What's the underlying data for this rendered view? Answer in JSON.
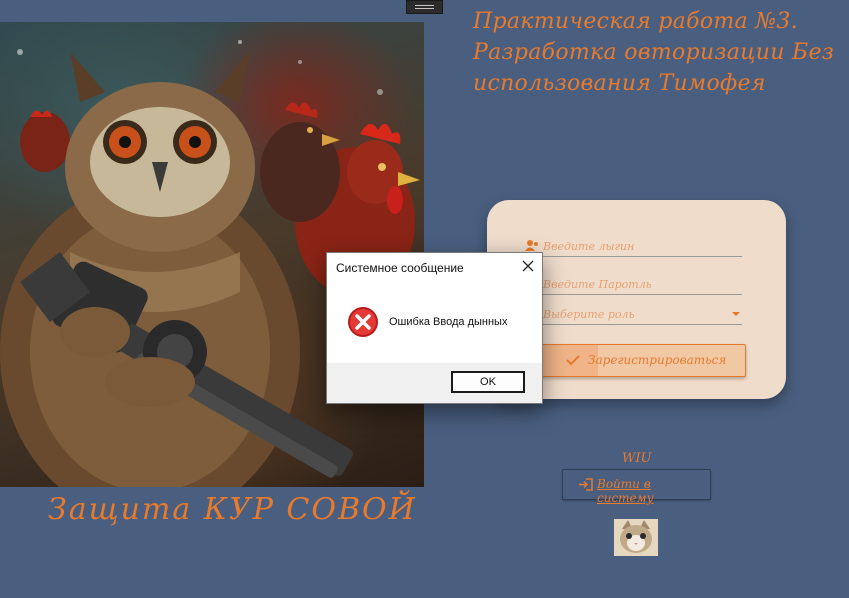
{
  "page": {
    "title": "Практическая работа №3. Разработка овторизации Без использования Тимофея",
    "caption": "Защита КУР СОВОЙ"
  },
  "form": {
    "login_placeholder": "Введите лыгин",
    "password_placeholder": "Введите Паротль",
    "role_placeholder": "Выберите роль",
    "register_label": "Зарегистрироваться"
  },
  "footer": {
    "wiu_label": "WIU",
    "login_button_label": "Войти в систему"
  },
  "dialog": {
    "title": "Системное сообщение",
    "message": "Ошибка Ввода дынных",
    "ok_label": "OK"
  },
  "icons": {
    "login_field": "users-icon",
    "password_field": "lock-icon",
    "role_field": "chevron-down-icon",
    "register": "check-icon",
    "login_button": "sign-in-icon",
    "dialog_error": "error-icon",
    "dialog_close": "close-icon"
  },
  "colors": {
    "background": "#4a5f80",
    "accent": "#e87a2c",
    "card": "#efdccb",
    "error": "#d32f2f"
  }
}
